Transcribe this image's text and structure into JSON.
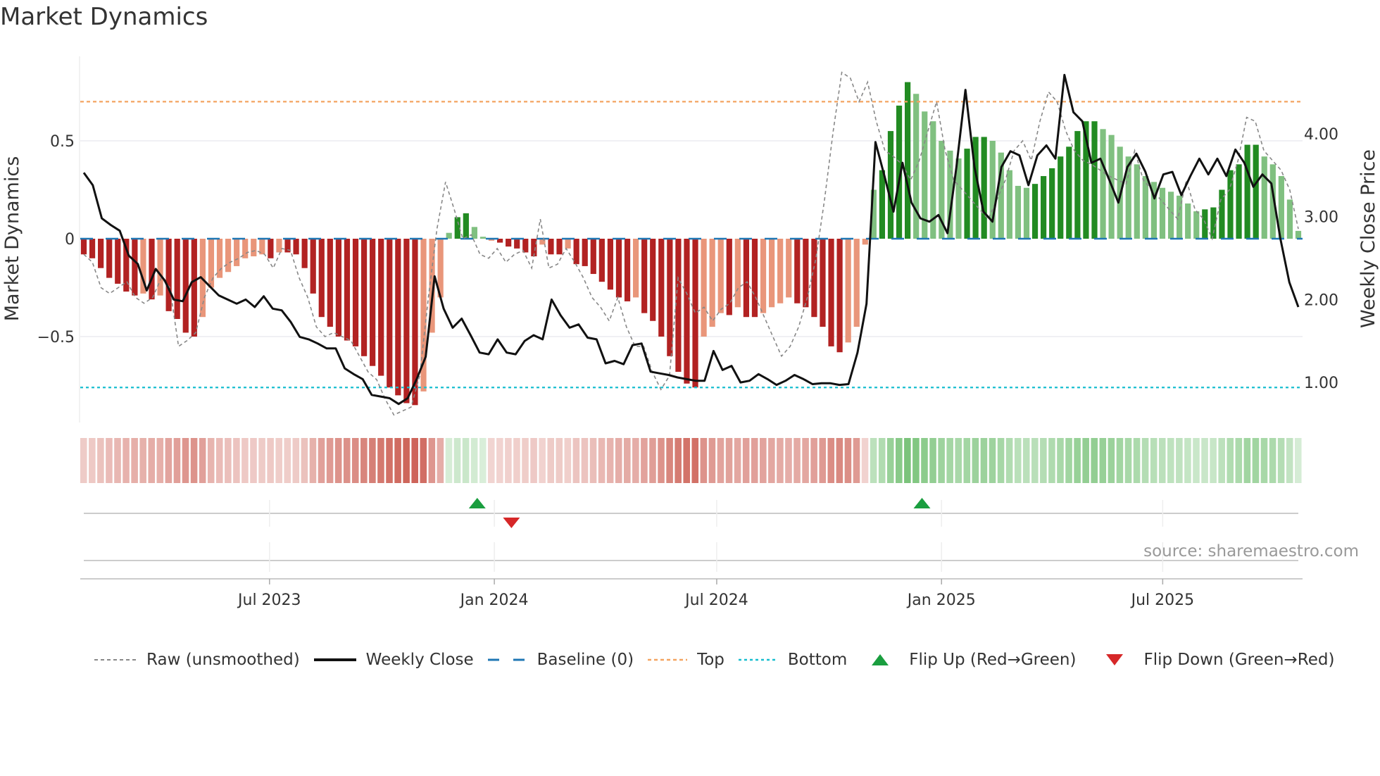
{
  "title": "Market Dynamics",
  "source": "source: sharemaestro.com",
  "legend": [
    {
      "label": "Raw (unsmoothed)",
      "icon": "dashed-gray-line"
    },
    {
      "label": "Weekly Close",
      "icon": "solid-black-line"
    },
    {
      "label": "Baseline (0)",
      "icon": "dashed-blue-line"
    },
    {
      "label": "Top",
      "icon": "dotted-orange-line"
    },
    {
      "label": "Bottom",
      "icon": "dotted-cyan-line"
    },
    {
      "label": "Flip Up (Red→Green)",
      "icon": "triangle-up-green"
    },
    {
      "label": "Flip Down (Green→Red)",
      "icon": "triangle-down-red"
    }
  ],
  "colors": {
    "neg_strong": "#b22222",
    "neg_weak": "#e9967a",
    "pos_strong": "#228b22",
    "pos_weak": "#80c080",
    "top": "#f4a460",
    "bottom": "#17becf",
    "baseline": "#1f77b4",
    "flip_up": "#1a9e3f",
    "flip_down": "#d62728"
  },
  "chart_data": {
    "type": "bar",
    "title": "Market Dynamics",
    "ylabel": "Market Dynamics",
    "y2label": "Weekly Close Price",
    "ylim": [
      -0.93,
      0.93
    ],
    "y2lim": [
      0.65,
      5.05
    ],
    "yticks": [
      {
        "v": 0.5,
        "label": "0.5"
      },
      {
        "v": 0,
        "label": "0"
      },
      {
        "v": -0.5,
        "label": "−0.5"
      }
    ],
    "y2ticks": [
      {
        "v": 4,
        "label": "4.00"
      },
      {
        "v": 3,
        "label": "3.00"
      },
      {
        "v": 2,
        "label": "2.00"
      },
      {
        "v": 1,
        "label": "1.00"
      }
    ],
    "xrange": [
      "2023-01-30",
      "2025-10-20"
    ],
    "xticks": [
      {
        "date": "2023-07-01",
        "label": "Jul 2023"
      },
      {
        "date": "2024-01-01",
        "label": "Jan 2024"
      },
      {
        "date": "2024-07-01",
        "label": "Jul 2024"
      },
      {
        "date": "2025-01-01",
        "label": "Jan 2025"
      },
      {
        "date": "2025-07-01",
        "label": "Jul 2025"
      }
    ],
    "top": 0.7,
    "bottom": -0.76,
    "baseline": 0,
    "dynamics": [
      -0.08,
      -0.1,
      -0.15,
      -0.2,
      -0.23,
      -0.27,
      -0.29,
      -0.28,
      -0.31,
      -0.29,
      -0.37,
      -0.41,
      -0.48,
      -0.5,
      -0.4,
      -0.25,
      -0.2,
      -0.17,
      -0.14,
      -0.1,
      -0.09,
      -0.08,
      -0.1,
      -0.07,
      -0.07,
      -0.08,
      -0.15,
      -0.28,
      -0.4,
      -0.45,
      -0.5,
      -0.52,
      -0.55,
      -0.6,
      -0.65,
      -0.7,
      -0.76,
      -0.8,
      -0.84,
      -0.85,
      -0.78,
      -0.48,
      -0.3,
      0.03,
      0.11,
      0.13,
      0.06,
      0.01,
      -0.01,
      -0.02,
      -0.04,
      -0.05,
      -0.07,
      -0.09,
      -0.03,
      -0.08,
      -0.08,
      -0.05,
      -0.13,
      -0.14,
      -0.18,
      -0.22,
      -0.26,
      -0.3,
      -0.32,
      -0.3,
      -0.38,
      -0.42,
      -0.5,
      -0.6,
      -0.68,
      -0.74,
      -0.76,
      -0.5,
      -0.45,
      -0.38,
      -0.39,
      -0.35,
      -0.4,
      -0.4,
      -0.38,
      -0.35,
      -0.33,
      -0.3,
      -0.33,
      -0.35,
      -0.4,
      -0.45,
      -0.55,
      -0.58,
      -0.53,
      -0.45,
      -0.03,
      0.25,
      0.35,
      0.55,
      0.68,
      0.8,
      0.74,
      0.65,
      0.6,
      0.5,
      0.45,
      0.41,
      0.46,
      0.52,
      0.52,
      0.5,
      0.44,
      0.35,
      0.27,
      0.26,
      0.28,
      0.32,
      0.36,
      0.42,
      0.47,
      0.55,
      0.6,
      0.6,
      0.56,
      0.53,
      0.47,
      0.42,
      0.38,
      0.32,
      0.29,
      0.26,
      0.24,
      0.22,
      0.18,
      0.14,
      0.15,
      0.16,
      0.25,
      0.35,
      0.38,
      0.48,
      0.48,
      0.42,
      0.38,
      0.32,
      0.2,
      0.04
    ],
    "raw": [
      -0.08,
      -0.12,
      -0.25,
      -0.28,
      -0.25,
      -0.22,
      -0.3,
      -0.33,
      -0.3,
      -0.2,
      -0.25,
      -0.55,
      -0.52,
      -0.48,
      -0.3,
      -0.2,
      -0.15,
      -0.12,
      -0.1,
      -0.07,
      -0.06,
      -0.08,
      -0.15,
      -0.05,
      -0.06,
      -0.2,
      -0.3,
      -0.45,
      -0.5,
      -0.48,
      -0.5,
      -0.52,
      -0.6,
      -0.68,
      -0.72,
      -0.82,
      -0.9,
      -0.88,
      -0.86,
      -0.7,
      -0.3,
      0.05,
      0.29,
      0.15,
      0.0,
      0.02,
      -0.08,
      -0.1,
      -0.05,
      -0.12,
      -0.08,
      -0.06,
      -0.15,
      0.1,
      -0.15,
      -0.13,
      -0.05,
      -0.12,
      -0.2,
      -0.3,
      -0.35,
      -0.42,
      -0.3,
      -0.45,
      -0.55,
      -0.55,
      -0.68,
      -0.77,
      -0.7,
      -0.2,
      -0.28,
      -0.38,
      -0.35,
      -0.42,
      -0.36,
      -0.33,
      -0.25,
      -0.22,
      -0.3,
      -0.4,
      -0.5,
      -0.6,
      -0.55,
      -0.45,
      -0.3,
      -0.1,
      0.2,
      0.55,
      0.85,
      0.82,
      0.7,
      0.8,
      0.6,
      0.45,
      0.42,
      0.38,
      0.3,
      0.4,
      0.55,
      0.7,
      0.45,
      0.3,
      0.25,
      0.2,
      0.15,
      0.1,
      0.2,
      0.3,
      0.45,
      0.5,
      0.4,
      0.6,
      0.75,
      0.7,
      0.55,
      0.45,
      0.4,
      0.38,
      0.35,
      0.32,
      0.3,
      0.28,
      0.45,
      0.3,
      0.25,
      0.2,
      0.15,
      0.1,
      0.3,
      0.15,
      0.1,
      0.0,
      0.2,
      0.25,
      0.4,
      0.62,
      0.6,
      0.45,
      0.4,
      0.35,
      0.25,
      0.05
    ],
    "weekly_close": [
      3.53,
      3.38,
      2.98,
      2.9,
      2.83,
      2.53,
      2.43,
      2.11,
      2.37,
      2.23,
      2.0,
      1.98,
      2.21,
      2.27,
      2.16,
      2.05,
      2.0,
      1.95,
      2.0,
      1.91,
      2.04,
      1.89,
      1.87,
      1.73,
      1.55,
      1.52,
      1.47,
      1.41,
      1.41,
      1.17,
      1.1,
      1.04,
      0.85,
      0.83,
      0.81,
      0.74,
      0.81,
      1.04,
      1.31,
      2.28,
      1.89,
      1.66,
      1.77,
      1.57,
      1.36,
      1.34,
      1.52,
      1.36,
      1.34,
      1.5,
      1.57,
      1.52,
      2.0,
      1.81,
      1.66,
      1.7,
      1.54,
      1.52,
      1.23,
      1.26,
      1.22,
      1.45,
      1.47,
      1.13,
      1.11,
      1.09,
      1.06,
      1.04,
      1.02,
      1.02,
      1.38,
      1.15,
      1.2,
      1.0,
      1.02,
      1.1,
      1.04,
      0.97,
      1.02,
      1.09,
      1.04,
      0.98,
      0.99,
      0.99,
      0.97,
      0.98,
      1.36,
      1.95,
      3.9,
      3.49,
      3.06,
      3.65,
      3.17,
      2.98,
      2.94,
      3.02,
      2.8,
      3.6,
      4.53,
      3.6,
      3.06,
      2.94,
      3.6,
      3.79,
      3.74,
      3.38,
      3.74,
      3.86,
      3.7,
      4.71,
      4.26,
      4.15,
      3.65,
      3.7,
      3.44,
      3.17,
      3.6,
      3.76,
      3.54,
      3.22,
      3.51,
      3.54,
      3.26,
      3.49,
      3.7,
      3.51,
      3.7,
      3.49,
      3.81,
      3.65,
      3.36,
      3.51,
      3.4,
      2.74,
      2.21,
      1.91
    ],
    "flips": [
      {
        "date": "2023-12-18",
        "type": "up"
      },
      {
        "date": "2024-01-15",
        "type": "down"
      },
      {
        "date": "2024-12-16",
        "type": "up"
      }
    ]
  }
}
